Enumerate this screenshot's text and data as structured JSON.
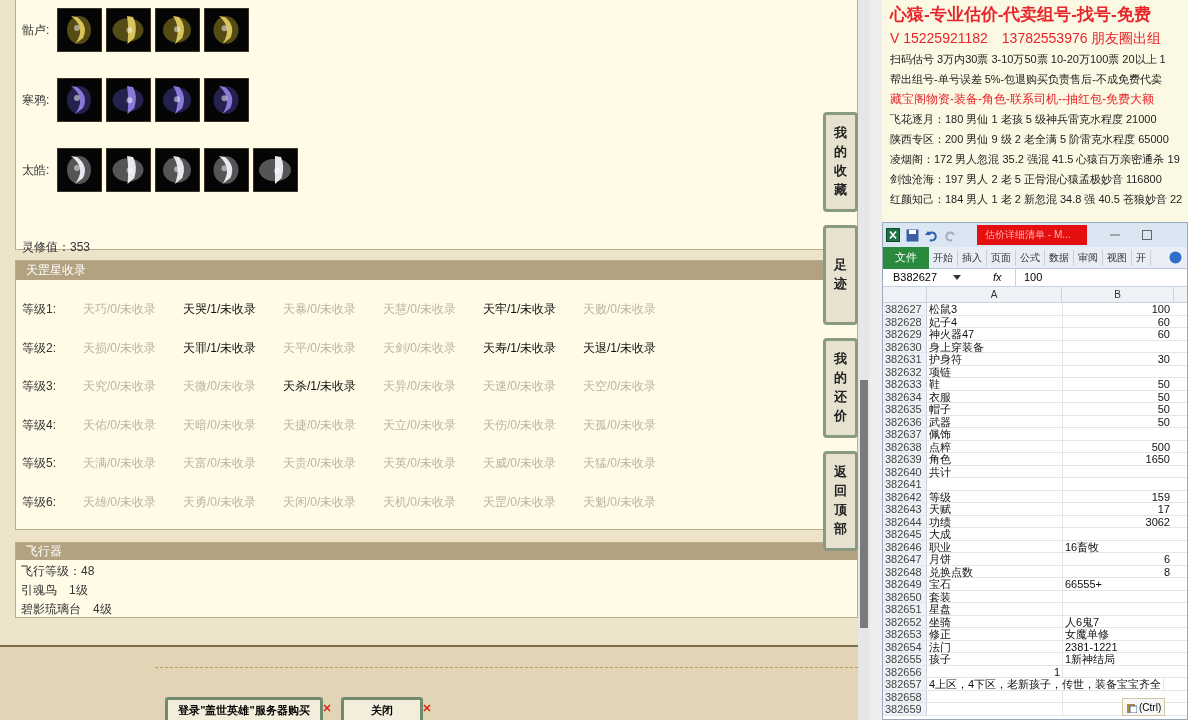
{
  "equipment_sets": [
    {
      "label": "骷卢:"
    },
    {
      "label": "寒鸦:"
    },
    {
      "label": "太皓:"
    }
  ],
  "spirit_value": "灵修值：353",
  "star_collection": {
    "title": "天罡星收录",
    "rows": [
      {
        "label": "等级1:",
        "entries": [
          {
            "text": "天巧/0/未收录",
            "collected": false
          },
          {
            "text": "天哭/1/未收录",
            "collected": true
          },
          {
            "text": "天暴/0/未收录",
            "collected": false
          },
          {
            "text": "天慧/0/未收录",
            "collected": false
          },
          {
            "text": "天牢/1/未收录",
            "collected": true
          },
          {
            "text": "天败/0/未收录",
            "collected": false
          }
        ]
      },
      {
        "label": "等级2:",
        "entries": [
          {
            "text": "天损/0/未收录",
            "collected": false
          },
          {
            "text": "天罪/1/未收录",
            "collected": true
          },
          {
            "text": "天平/0/未收录",
            "collected": false
          },
          {
            "text": "天剑/0/未收录",
            "collected": false
          },
          {
            "text": "天寿/1/未收录",
            "collected": true
          },
          {
            "text": "天退/1/未收录",
            "collected": true
          }
        ]
      },
      {
        "label": "等级3:",
        "entries": [
          {
            "text": "天究/0/未收录",
            "collected": false
          },
          {
            "text": "天微/0/未收录",
            "collected": false
          },
          {
            "text": "天杀/1/未收录",
            "collected": true
          },
          {
            "text": "天异/0/未收录",
            "collected": false
          },
          {
            "text": "天速/0/未收录",
            "collected": false
          },
          {
            "text": "天空/0/未收录",
            "collected": false
          }
        ]
      },
      {
        "label": "等级4:",
        "entries": [
          {
            "text": "天佑/0/未收录",
            "collected": false
          },
          {
            "text": "天暗/0/未收录",
            "collected": false
          },
          {
            "text": "天捷/0/未收录",
            "collected": false
          },
          {
            "text": "天立/0/未收录",
            "collected": false
          },
          {
            "text": "天伤/0/未收录",
            "collected": false
          },
          {
            "text": "天孤/0/未收录",
            "collected": false
          }
        ]
      },
      {
        "label": "等级5:",
        "entries": [
          {
            "text": "天满/0/未收录",
            "collected": false
          },
          {
            "text": "天富/0/未收录",
            "collected": false
          },
          {
            "text": "天贵/0/未收录",
            "collected": false
          },
          {
            "text": "天英/0/未收录",
            "collected": false
          },
          {
            "text": "天威/0/未收录",
            "collected": false
          },
          {
            "text": "天猛/0/未收录",
            "collected": false
          }
        ]
      },
      {
        "label": "等级6:",
        "entries": [
          {
            "text": "天雄/0/未收录",
            "collected": false
          },
          {
            "text": "天勇/0/未收录",
            "collected": false
          },
          {
            "text": "天闲/0/未收录",
            "collected": false
          },
          {
            "text": "天机/0/未收录",
            "collected": false
          },
          {
            "text": "天罡/0/未收录",
            "collected": false
          },
          {
            "text": "天魁/0/未收录",
            "collected": false
          }
        ]
      }
    ]
  },
  "aircraft": {
    "title": "飞行器",
    "lines": [
      "飞行等级：48",
      "引魂鸟　1级",
      "碧影琉璃台　4级"
    ]
  },
  "buttons": [
    {
      "label": "登录\"盖世英雄\"服务器购买"
    },
    {
      "label": "关闭"
    }
  ],
  "side_buttons": [
    {
      "label": "我的收藏"
    },
    {
      "label": "足迹"
    },
    {
      "label": "我的还价"
    },
    {
      "label": "返回顶部"
    }
  ],
  "document": {
    "lines": [
      {
        "text": "心猿-专业估价-代卖组号-找号-免费",
        "kind": "title"
      },
      {
        "text": "V 15225921182　13782553976 朋友圈出组",
        "kind": "contact"
      },
      {
        "text": "扫码估号 3万内30票 3-10万50票 10-20万100票 20以上 1",
        "kind": "plain"
      },
      {
        "text": "帮出组号-单号误差 5%-包退购买负责售后-不成免费代卖",
        "kind": "plain"
      },
      {
        "text": "藏宝阁物资-装备-角色-联系司机--抽红包-免费大额",
        "kind": "highlight"
      },
      {
        "text": "飞花逐月：180 男仙 1 老孩 5 级神兵雷克水程度 21000",
        "kind": "plain"
      },
      {
        "text": "陕西专区：200 男仙 9 级 2 老全满 5 阶雷克水程度 65000",
        "kind": "plain"
      },
      {
        "text": "凌烟阁：172 男人忽混 35.2 强混 41.5 心猿百万亲密通杀 19",
        "kind": "plain"
      },
      {
        "text": "剑蚀沧海：197 男人 2 老 5 正骨混心猿孟极妙音 116800",
        "kind": "plain"
      },
      {
        "text": "红颜知己：184 男人 1 老 2 新忽混 34.8 强 40.5 苍狼妙音 22",
        "kind": "plain"
      }
    ]
  },
  "spreadsheet": {
    "title": "估价详细清单 - M...",
    "ribbon_tabs": [
      {
        "label": "文件",
        "selected": true
      },
      {
        "label": "开始",
        "selected": false
      },
      {
        "label": "插入",
        "selected": false
      },
      {
        "label": "页面",
        "selected": false
      },
      {
        "label": "公式",
        "selected": false
      },
      {
        "label": "数据",
        "selected": false
      },
      {
        "label": "审阅",
        "selected": false
      },
      {
        "label": "视图",
        "selected": false
      },
      {
        "label": "开",
        "selected": false
      }
    ],
    "name_box": "B382627",
    "function_label": "fx",
    "formula": "100",
    "columns": [
      "A",
      "B"
    ],
    "rows": [
      {
        "n": "382627",
        "a": "松鼠3",
        "b": "100",
        "numeric": true
      },
      {
        "n": "382628",
        "a": "妃子4",
        "b": "60",
        "numeric": true
      },
      {
        "n": "382629",
        "a": "神火器47",
        "b": "60",
        "numeric": true
      },
      {
        "n": "382630",
        "a": "身上穿装备"
      },
      {
        "n": "382631",
        "a": "护身符",
        "b": "30",
        "numeric": true
      },
      {
        "n": "382632",
        "a": "项链"
      },
      {
        "n": "382633",
        "a": "鞋",
        "b": "50",
        "numeric": true
      },
      {
        "n": "382634",
        "a": "衣服",
        "b": "50",
        "numeric": true
      },
      {
        "n": "382635",
        "a": "帽子",
        "b": "50",
        "numeric": true
      },
      {
        "n": "382636",
        "a": "武器",
        "b": "50",
        "numeric": true
      },
      {
        "n": "382637",
        "a": "佩饰"
      },
      {
        "n": "382638",
        "a": "点粹",
        "b": "500",
        "numeric": true
      },
      {
        "n": "382639",
        "a": "角色",
        "b": "1650",
        "numeric": true
      },
      {
        "n": "382640",
        "a": "共计"
      },
      {
        "n": "382641"
      },
      {
        "n": "382642",
        "a": "等级",
        "b": "159",
        "numeric": true
      },
      {
        "n": "382643",
        "a": "天赋",
        "b": "17",
        "numeric": true
      },
      {
        "n": "382644",
        "a": "功绩",
        "b": "3062",
        "numeric": true
      },
      {
        "n": "382645",
        "a": "大成"
      },
      {
        "n": "382646",
        "a": "职业",
        "b": "16畜牧",
        "numeric": false
      },
      {
        "n": "382647",
        "a": "月饼",
        "b": "6",
        "numeric": true
      },
      {
        "n": "382648",
        "a": "兑换点数",
        "b": "8",
        "numeric": true
      },
      {
        "n": "382649",
        "a": "宝石",
        "b": "66555+",
        "numeric": false
      },
      {
        "n": "382650",
        "a": "套装"
      },
      {
        "n": "382651",
        "a": "星盘"
      },
      {
        "n": "382652",
        "a": "坐骑",
        "b": "人6鬼7"
      },
      {
        "n": "382653",
        "a": "修正",
        "b": "女魔单修"
      },
      {
        "n": "382654",
        "a": "法门",
        "b": "2381-1221"
      },
      {
        "n": "382655",
        "a": "孩子",
        "b": "1新神结局"
      },
      {
        "n": "382656",
        "a": "1",
        "numeric": true
      },
      {
        "n": "382657",
        "a": "4上区，4下区，老新孩子，传世，装备宝宝齐全"
      },
      {
        "n": "382658"
      },
      {
        "n": "382659"
      }
    ],
    "paste_button": "(Ctrl)"
  }
}
